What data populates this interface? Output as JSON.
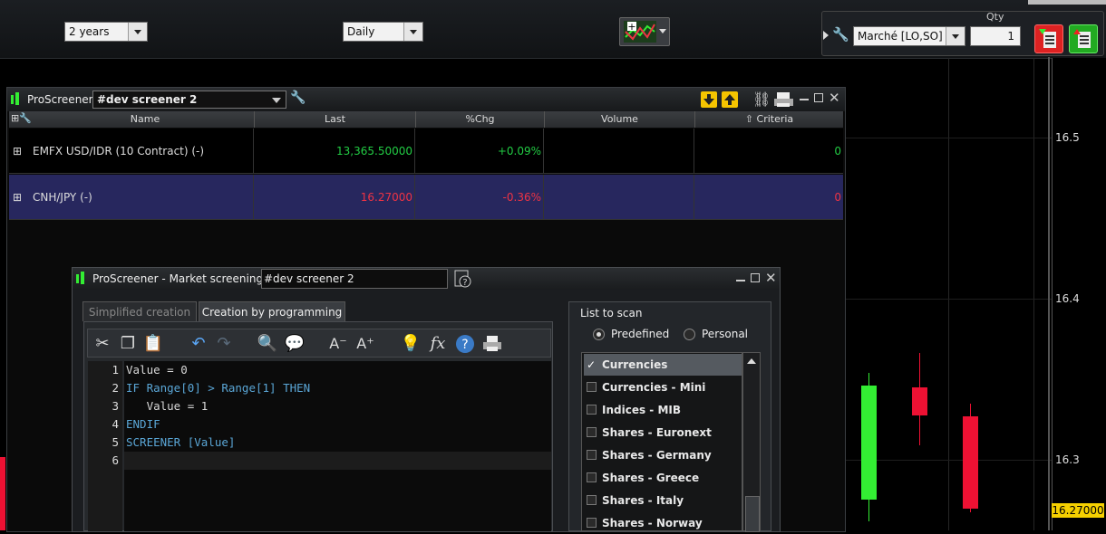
{
  "toolbar": {
    "period": "2 years",
    "interval": "Daily"
  },
  "order": {
    "market": "Marché [LO,SO]",
    "qty_label": "Qty",
    "qty_value": "1"
  },
  "chart": {
    "price_labels": [
      "16.5",
      "16.4",
      "16.3"
    ],
    "last_price": "16.27000",
    "colors": {
      "up": "#33ee33",
      "down": "#ee1133",
      "last_price_tag": "#f5d000"
    }
  },
  "screener": {
    "title": "ProScreener",
    "selected": "#dev screener 2",
    "columns": [
      "Name",
      "Last",
      "%Chg",
      "Volume",
      "Criteria"
    ],
    "rows": [
      {
        "name": "EMFX USD/IDR (10 Contract) (-)",
        "last": "13,365.50000",
        "chg": "+0.09%",
        "volume": "",
        "criteria": "0",
        "color": "#22cc44"
      },
      {
        "name": "CNH/JPY (-)",
        "last": "16.27000",
        "chg": "-0.36%",
        "volume": "",
        "criteria": "0",
        "color": "#ee3344"
      }
    ]
  },
  "market_screening": {
    "title": "ProScreener - Market screening  -",
    "name": "#dev screener 2",
    "tabs": [
      "Simplified creation",
      "Creation by programming"
    ],
    "code": {
      "line_numbers": [
        "1",
        "2",
        "3",
        "4",
        "5",
        "6"
      ],
      "lines": [
        "Value = 0",
        "IF Range[0] > Range[1] THEN",
        "   Value = 1",
        "ENDIF",
        "SCREENER [Value]",
        ""
      ]
    },
    "list_to_scan": {
      "label": "List to scan",
      "predefined": "Predefined",
      "personal": "Personal",
      "items": [
        "Currencies",
        "Currencies - Mini",
        "Indices - MIB",
        "Shares - Euronext",
        "Shares - Germany",
        "Shares - Greece",
        "Shares - Italy",
        "Shares - Norway"
      ]
    }
  }
}
